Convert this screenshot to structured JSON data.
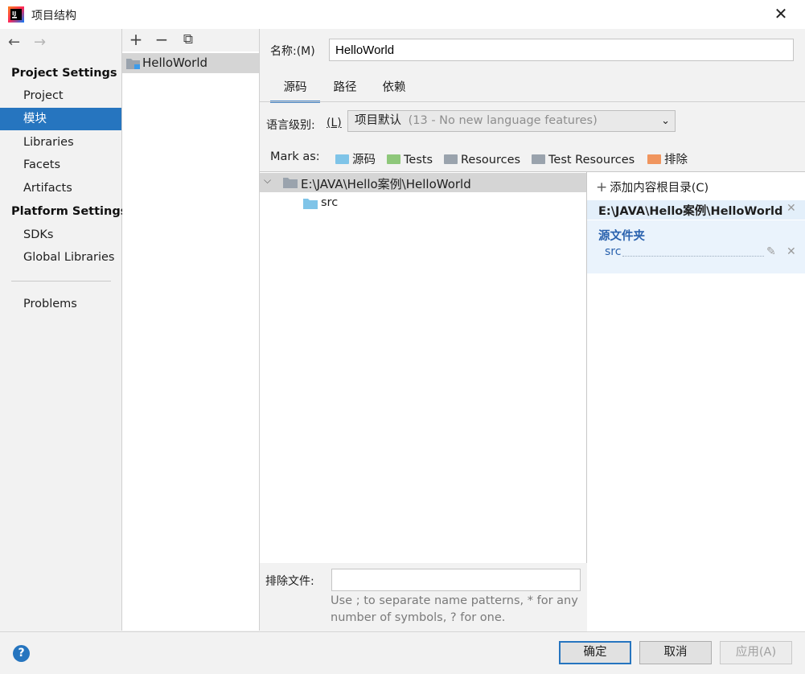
{
  "window": {
    "title": "项目结构",
    "close_label": "✕"
  },
  "nav": {
    "back_label": "←",
    "forward_label": "→",
    "project_settings": "Project Settings",
    "platform_settings": "Platform Settings",
    "items": [
      {
        "label": "Project"
      },
      {
        "label": "模块"
      },
      {
        "label": "Libraries"
      },
      {
        "label": "Facets"
      },
      {
        "label": "Artifacts"
      },
      {
        "label": "SDKs"
      },
      {
        "label": "Global Libraries"
      },
      {
        "label": "Problems"
      }
    ]
  },
  "modules": {
    "toolbar": {
      "add": "+",
      "remove": "−",
      "copy": "⧉"
    },
    "items": [
      {
        "label": "HelloWorld"
      }
    ]
  },
  "module": {
    "name_label": "名称:(M)",
    "name_value": "HelloWorld",
    "tabs": [
      {
        "label": "源码"
      },
      {
        "label": "路径"
      },
      {
        "label": "依赖"
      }
    ],
    "lang_label": "语言级别:",
    "lang_shortcut": "(L)",
    "lang_value": "项目默认",
    "lang_detail": "(13 - No new language features)",
    "mark_as_label": "Mark as:",
    "mark_as": [
      {
        "label": "源码",
        "color": "#7fc4e8"
      },
      {
        "label": "Tests",
        "color": "#8ec77a"
      },
      {
        "label": "Resources",
        "color": "#9aa3ad"
      },
      {
        "label": "Test Resources",
        "color": "#9aa3ad"
      },
      {
        "label": "排除",
        "color": "#f0955e"
      }
    ]
  },
  "tree": {
    "root": "E:\\JAVA\\Hello案例\\HelloWorld",
    "child": "src"
  },
  "content_root": {
    "add_label": "添加内容根目录(C)",
    "path": "E:\\JAVA\\Hello案例\\HelloWorld",
    "source_header": "源文件夹",
    "source_item": "src"
  },
  "exclude": {
    "label": "排除文件:",
    "value": "",
    "hint_line1": "Use ; to separate name patterns, * for any",
    "hint_line2": "number of symbols, ? for one."
  },
  "buttons": {
    "ok": "确定",
    "cancel": "取消",
    "apply": "应用(A)",
    "help": "?"
  },
  "colors": {
    "accent": "#2675bf",
    "selection": "#d5d5d5"
  }
}
